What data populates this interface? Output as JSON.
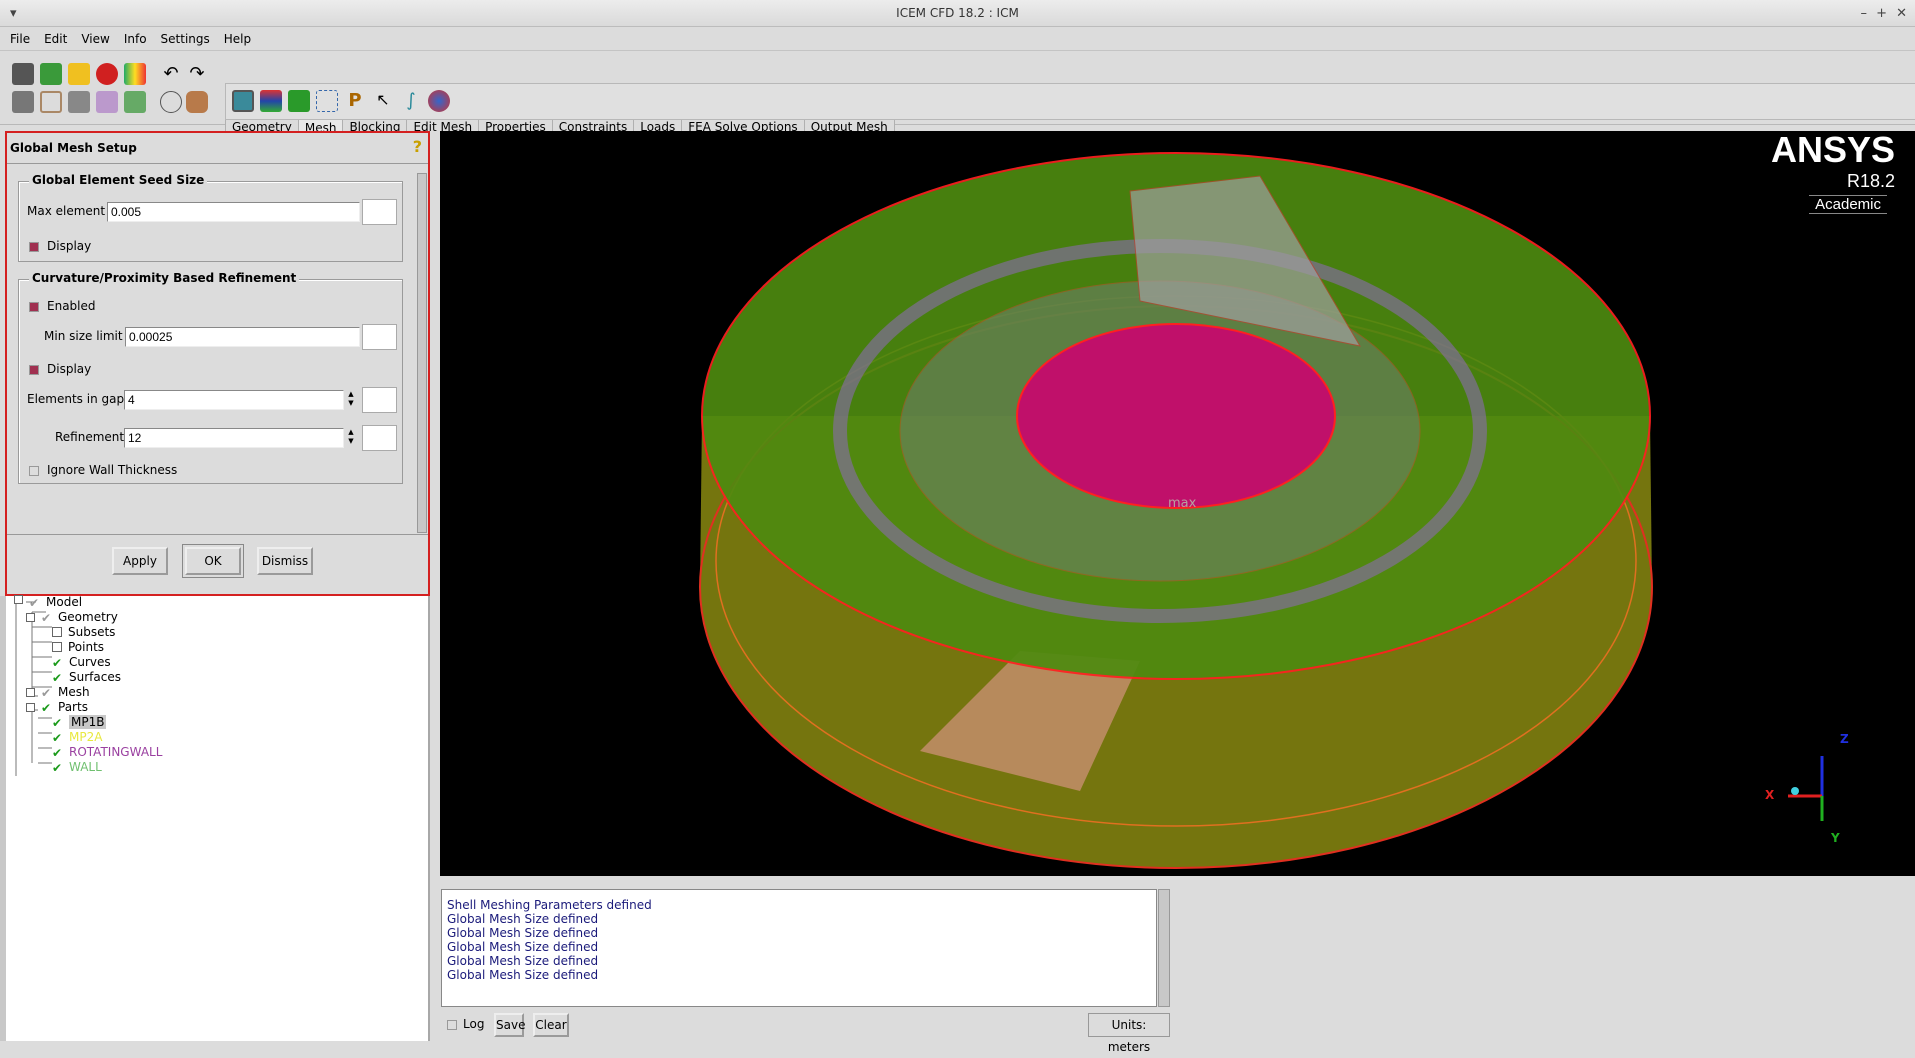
{
  "window": {
    "title": "ICEM CFD 18.2 : ICM"
  },
  "menu": [
    "File",
    "Edit",
    "View",
    "Info",
    "Settings",
    "Help"
  ],
  "toolbar": {
    "tabs": [
      "Geometry",
      "Mesh",
      "Blocking",
      "Edit Mesh",
      "Properties",
      "Constraints",
      "Loads",
      "FEA Solve Options",
      "Output Mesh"
    ],
    "active_tab": "Mesh"
  },
  "panel": {
    "title": "Global Mesh Setup",
    "seed": {
      "heading": "Global Element Seed Size",
      "max_element_label": "Max element",
      "max_element_value": "0.005",
      "display_label": "Display",
      "display_checked": true
    },
    "refinement": {
      "heading": "Curvature/Proximity Based Refinement",
      "enabled_label": "Enabled",
      "enabled_checked": true,
      "min_size_label": "Min size limit",
      "min_size_value": "0.00025",
      "display_label": "Display",
      "display_checked": true,
      "gap_label": "Elements in gap",
      "gap_value": "4",
      "refinement_label": "Refinement",
      "refinement_value": "12",
      "ignore_wall_label": "Ignore Wall Thickness",
      "ignore_wall_checked": false
    },
    "buttons": {
      "apply": "Apply",
      "ok": "OK",
      "dismiss": "Dismiss"
    }
  },
  "tree": {
    "model": "Model",
    "geometry": "Geometry",
    "subsets": "Subsets",
    "points": "Points",
    "curves": "Curves",
    "surfaces": "Surfaces",
    "mesh": "Mesh",
    "parts": "Parts",
    "part_items": [
      {
        "name": "MP1B",
        "color": "#000000"
      },
      {
        "name": "MP2A",
        "color": "#e8e840"
      },
      {
        "name": "ROTATINGWALL",
        "color": "#9a40a0"
      },
      {
        "name": "WALL",
        "color": "#70c070"
      }
    ]
  },
  "viewport": {
    "brand": "ANSYS",
    "version": "R18.2",
    "edition": "Academic",
    "axes": {
      "x": "X",
      "y": "Y",
      "z": "Z"
    }
  },
  "messages": [
    "Shell Meshing Parameters defined",
    "Global Mesh Size defined",
    "Global Mesh Size defined",
    "Global Mesh Size defined",
    "Global Mesh Size defined",
    "Global Mesh Size defined"
  ],
  "bottom": {
    "log_label": "Log",
    "save": "Save",
    "clear": "Clear",
    "units": "Units: meters"
  }
}
